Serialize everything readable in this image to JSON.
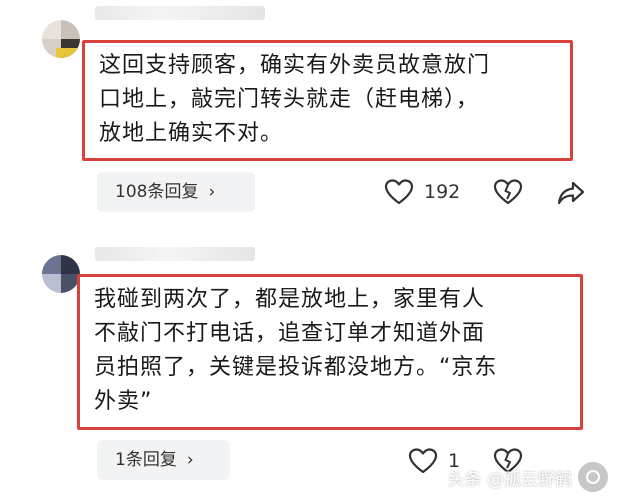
{
  "comments": [
    {
      "text": "这回支持顾客，确实有外卖员故意放门\n口地上，敲完门转头就走（赶电梯），\n放地上确实不对。",
      "reply_label": "108条回复",
      "like_count": "192"
    },
    {
      "text": "我碰到两次了，都是放地上，家里有人\n不敲门不打电话，追查订单才知道外面\n员拍照了，关键是投诉都没地方。“京东\n外卖”",
      "reply_label": "1条回复",
      "like_count": "1"
    }
  ],
  "icons": {
    "chevron": "›",
    "like": "heart-outline-icon",
    "dislike": "broken-heart-icon",
    "share": "share-arrow-icon"
  },
  "watermark": {
    "text": "头条 @孤云野鹤"
  },
  "colors": {
    "highlight_border": "#d9423a",
    "reply_bg": "#f2f3f5"
  }
}
